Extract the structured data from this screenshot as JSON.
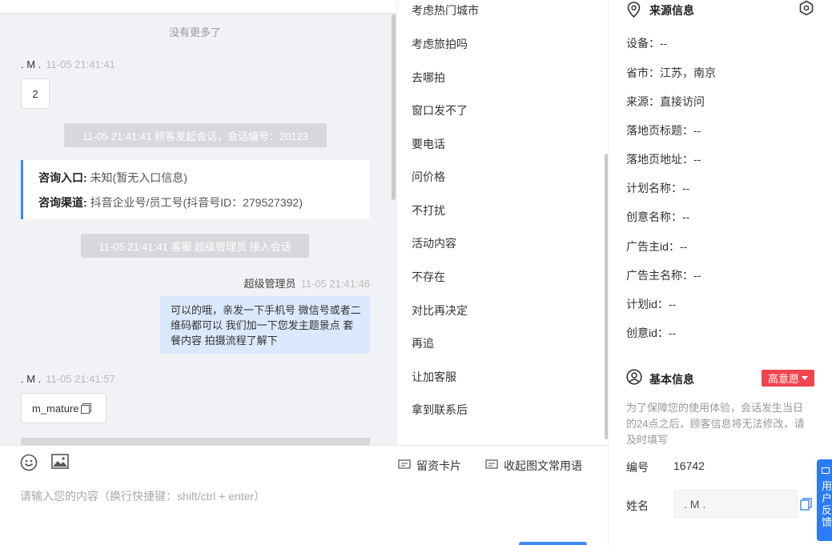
{
  "chat": {
    "no_more": "没有更多了",
    "messages": [
      {
        "sender": ". M .",
        "time": "11-05 21:41:41",
        "text": "2"
      }
    ],
    "system_start": "11-05 21:41:41 顾客发起会话，会话编号：20123",
    "info_card": {
      "entry_label": "咨询入口:",
      "entry_value": "未知(暂无入口信息)",
      "channel_label": "咨询渠道:",
      "channel_value": "抖音企业号/员工号(抖音号ID：279527392)"
    },
    "system_join": "11-05 21:41:41 客服 超级管理员 接入会话",
    "agent": {
      "name": "超级管理员",
      "time": "11-05 21:41:46",
      "text": "可以的哦，亲发一下手机号 微信号或者二维码都可以 我们加一下您发主题景点 套餐内容 拍摄流程了解下"
    },
    "customer2": {
      "sender": ". M .",
      "time": "11-05 21:41:57",
      "text": "m_mature"
    }
  },
  "phrases": [
    "考虑热门城市",
    "考虑旅拍吗",
    "去哪拍",
    "窗口发不了",
    "要电话",
    "问价格",
    "不打扰",
    "活动内容",
    "不存在",
    "对比再决定",
    "再追",
    "让加客服",
    "拿到联系后"
  ],
  "composer": {
    "emoji_icon": "smile-icon",
    "image_icon": "image-icon",
    "card_label": "留资卡片",
    "collapse_label": "收起图文常用语",
    "placeholder": "请输入您的内容（换行快捷键：shift/ctrl + enter）"
  },
  "source": {
    "title": "来源信息",
    "rows": [
      "设备：--",
      "省市：江苏，南京",
      "来源：直接访问",
      "落地页标题：--",
      "落地页地址：--",
      "计划名称：--",
      "创意名称：--",
      "广告主id：--",
      "广告主名称：--",
      "计划id：--",
      "创意id：--"
    ]
  },
  "basic": {
    "title": "基本信息",
    "intent": "高意愿",
    "notice": "为了保障您的使用体验，会话发生当日的24点之后，顾客信息将无法修改，请及时填写",
    "id_label": "编号",
    "id_value": "16742",
    "name_label": "姓名",
    "name_value": ". M ."
  },
  "feedback": "用户反馈",
  "colors": {
    "accent": "#3f87f5",
    "badge": "#f0454d",
    "agent_bubble": "#dbe8fd"
  }
}
